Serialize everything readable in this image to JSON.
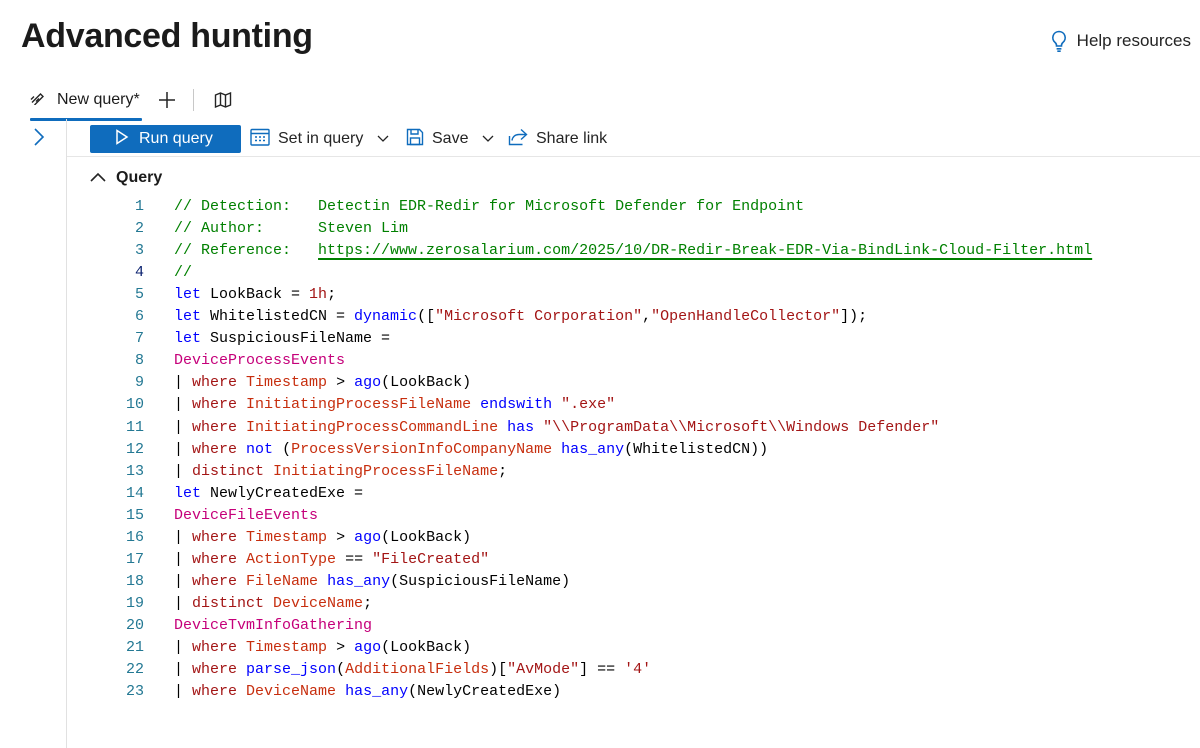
{
  "page": {
    "title": "Advanced hunting",
    "help_label": "Help resources"
  },
  "tabs": {
    "items": [
      {
        "label": "New query*"
      }
    ]
  },
  "toolbar": {
    "run_label": "Run query",
    "set_in_query_label": "Set in query",
    "save_label": "Save",
    "share_label": "Share link"
  },
  "query_section": {
    "label": "Query"
  },
  "colors": {
    "accent": "#0f6cbd",
    "comment": "#008000",
    "keyword": "#0000ff",
    "string": "#a31515",
    "table": "#c5007a",
    "column": "#c72e0e",
    "line_number": "#237893"
  },
  "editor": {
    "lines": [
      {
        "num": "1",
        "tokens": [
          {
            "t": "// Detection:   ",
            "c": "comment"
          },
          {
            "t": "Detectin EDR-Redir for Microsoft Defender for Endpoint",
            "c": "comment"
          }
        ]
      },
      {
        "num": "2",
        "tokens": [
          {
            "t": "// Author:      ",
            "c": "comment"
          },
          {
            "t": "Steven Lim",
            "c": "comment"
          }
        ]
      },
      {
        "num": "3",
        "tokens": [
          {
            "t": "// Reference:   ",
            "c": "comment"
          },
          {
            "t": "https://www.zerosalarium.com/2025/10/DR-Redir-Break-EDR-Via-BindLink-Cloud-Filter.html",
            "c": "link"
          }
        ]
      },
      {
        "num": "4",
        "current": true,
        "tokens": [
          {
            "t": "//",
            "c": "comment"
          }
        ]
      },
      {
        "num": "5",
        "tokens": [
          {
            "t": "let",
            "c": "kw"
          },
          {
            "t": " LookBack = ",
            "c": "plain"
          },
          {
            "t": "1h",
            "c": "str"
          },
          {
            "t": ";",
            "c": "plain"
          }
        ]
      },
      {
        "num": "6",
        "tokens": [
          {
            "t": "let",
            "c": "kw"
          },
          {
            "t": " WhitelistedCN = ",
            "c": "plain"
          },
          {
            "t": "dynamic",
            "c": "fn"
          },
          {
            "t": "([",
            "c": "plain"
          },
          {
            "t": "\"Microsoft Corporation\"",
            "c": "str"
          },
          {
            "t": ",",
            "c": "plain"
          },
          {
            "t": "\"OpenHandleCollector\"",
            "c": "str"
          },
          {
            "t": "]);",
            "c": "plain"
          }
        ]
      },
      {
        "num": "7",
        "tokens": [
          {
            "t": "let",
            "c": "kw"
          },
          {
            "t": " SuspiciousFileName =",
            "c": "plain"
          }
        ]
      },
      {
        "num": "8",
        "tokens": [
          {
            "t": "DeviceProcessEvents",
            "c": "tbl"
          }
        ]
      },
      {
        "num": "9",
        "tokens": [
          {
            "t": "| ",
            "c": "plain"
          },
          {
            "t": "where",
            "c": "op"
          },
          {
            "t": " ",
            "c": "plain"
          },
          {
            "t": "Timestamp",
            "c": "col"
          },
          {
            "t": " > ",
            "c": "plain"
          },
          {
            "t": "ago",
            "c": "fn"
          },
          {
            "t": "(LookBack)",
            "c": "plain"
          }
        ]
      },
      {
        "num": "10",
        "tokens": [
          {
            "t": "| ",
            "c": "plain"
          },
          {
            "t": "where",
            "c": "op"
          },
          {
            "t": " ",
            "c": "plain"
          },
          {
            "t": "InitiatingProcessFileName",
            "c": "col"
          },
          {
            "t": " ",
            "c": "plain"
          },
          {
            "t": "endswith",
            "c": "kw"
          },
          {
            "t": " ",
            "c": "plain"
          },
          {
            "t": "\".exe\"",
            "c": "str"
          }
        ]
      },
      {
        "num": "11",
        "tokens": [
          {
            "t": "| ",
            "c": "plain"
          },
          {
            "t": "where",
            "c": "op"
          },
          {
            "t": " ",
            "c": "plain"
          },
          {
            "t": "InitiatingProcessCommandLine",
            "c": "col"
          },
          {
            "t": " ",
            "c": "plain"
          },
          {
            "t": "has",
            "c": "kw"
          },
          {
            "t": " ",
            "c": "plain"
          },
          {
            "t": "\"\\\\ProgramData\\\\Microsoft\\\\Windows Defender\"",
            "c": "str"
          }
        ]
      },
      {
        "num": "12",
        "tokens": [
          {
            "t": "| ",
            "c": "plain"
          },
          {
            "t": "where",
            "c": "op"
          },
          {
            "t": " ",
            "c": "plain"
          },
          {
            "t": "not",
            "c": "kw"
          },
          {
            "t": " (",
            "c": "plain"
          },
          {
            "t": "ProcessVersionInfoCompanyName",
            "c": "col"
          },
          {
            "t": " ",
            "c": "plain"
          },
          {
            "t": "has_any",
            "c": "kw"
          },
          {
            "t": "(WhitelistedCN))",
            "c": "plain"
          }
        ]
      },
      {
        "num": "13",
        "tokens": [
          {
            "t": "| ",
            "c": "plain"
          },
          {
            "t": "distinct",
            "c": "op"
          },
          {
            "t": " ",
            "c": "plain"
          },
          {
            "t": "InitiatingProcessFileName",
            "c": "col"
          },
          {
            "t": ";",
            "c": "plain"
          }
        ]
      },
      {
        "num": "14",
        "tokens": [
          {
            "t": "let",
            "c": "kw"
          },
          {
            "t": " NewlyCreatedExe =",
            "c": "plain"
          }
        ]
      },
      {
        "num": "15",
        "tokens": [
          {
            "t": "DeviceFileEvents",
            "c": "tbl"
          }
        ]
      },
      {
        "num": "16",
        "tokens": [
          {
            "t": "| ",
            "c": "plain"
          },
          {
            "t": "where",
            "c": "op"
          },
          {
            "t": " ",
            "c": "plain"
          },
          {
            "t": "Timestamp",
            "c": "col"
          },
          {
            "t": " > ",
            "c": "plain"
          },
          {
            "t": "ago",
            "c": "fn"
          },
          {
            "t": "(LookBack)",
            "c": "plain"
          }
        ]
      },
      {
        "num": "17",
        "tokens": [
          {
            "t": "| ",
            "c": "plain"
          },
          {
            "t": "where",
            "c": "op"
          },
          {
            "t": " ",
            "c": "plain"
          },
          {
            "t": "ActionType",
            "c": "col"
          },
          {
            "t": " == ",
            "c": "plain"
          },
          {
            "t": "\"FileCreated\"",
            "c": "str"
          }
        ]
      },
      {
        "num": "18",
        "tokens": [
          {
            "t": "| ",
            "c": "plain"
          },
          {
            "t": "where",
            "c": "op"
          },
          {
            "t": " ",
            "c": "plain"
          },
          {
            "t": "FileName",
            "c": "col"
          },
          {
            "t": " ",
            "c": "plain"
          },
          {
            "t": "has_any",
            "c": "kw"
          },
          {
            "t": "(SuspiciousFileName)",
            "c": "plain"
          }
        ]
      },
      {
        "num": "19",
        "tokens": [
          {
            "t": "| ",
            "c": "plain"
          },
          {
            "t": "distinct",
            "c": "op"
          },
          {
            "t": " ",
            "c": "plain"
          },
          {
            "t": "DeviceName",
            "c": "col"
          },
          {
            "t": ";",
            "c": "plain"
          }
        ]
      },
      {
        "num": "20",
        "tokens": [
          {
            "t": "DeviceTvmInfoGathering",
            "c": "tbl"
          }
        ]
      },
      {
        "num": "21",
        "tokens": [
          {
            "t": "| ",
            "c": "plain"
          },
          {
            "t": "where",
            "c": "op"
          },
          {
            "t": " ",
            "c": "plain"
          },
          {
            "t": "Timestamp",
            "c": "col"
          },
          {
            "t": " > ",
            "c": "plain"
          },
          {
            "t": "ago",
            "c": "fn"
          },
          {
            "t": "(LookBack)",
            "c": "plain"
          }
        ]
      },
      {
        "num": "22",
        "tokens": [
          {
            "t": "| ",
            "c": "plain"
          },
          {
            "t": "where",
            "c": "op"
          },
          {
            "t": " ",
            "c": "plain"
          },
          {
            "t": "parse_json",
            "c": "fn"
          },
          {
            "t": "(",
            "c": "plain"
          },
          {
            "t": "AdditionalFields",
            "c": "col"
          },
          {
            "t": ")[",
            "c": "plain"
          },
          {
            "t": "\"AvMode\"",
            "c": "str"
          },
          {
            "t": "] == ",
            "c": "plain"
          },
          {
            "t": "'4'",
            "c": "str"
          }
        ]
      },
      {
        "num": "23",
        "tokens": [
          {
            "t": "| ",
            "c": "plain"
          },
          {
            "t": "where",
            "c": "op"
          },
          {
            "t": " ",
            "c": "plain"
          },
          {
            "t": "DeviceName",
            "c": "col"
          },
          {
            "t": " ",
            "c": "plain"
          },
          {
            "t": "has_any",
            "c": "kw"
          },
          {
            "t": "(NewlyCreatedExe)",
            "c": "plain"
          }
        ]
      }
    ]
  }
}
